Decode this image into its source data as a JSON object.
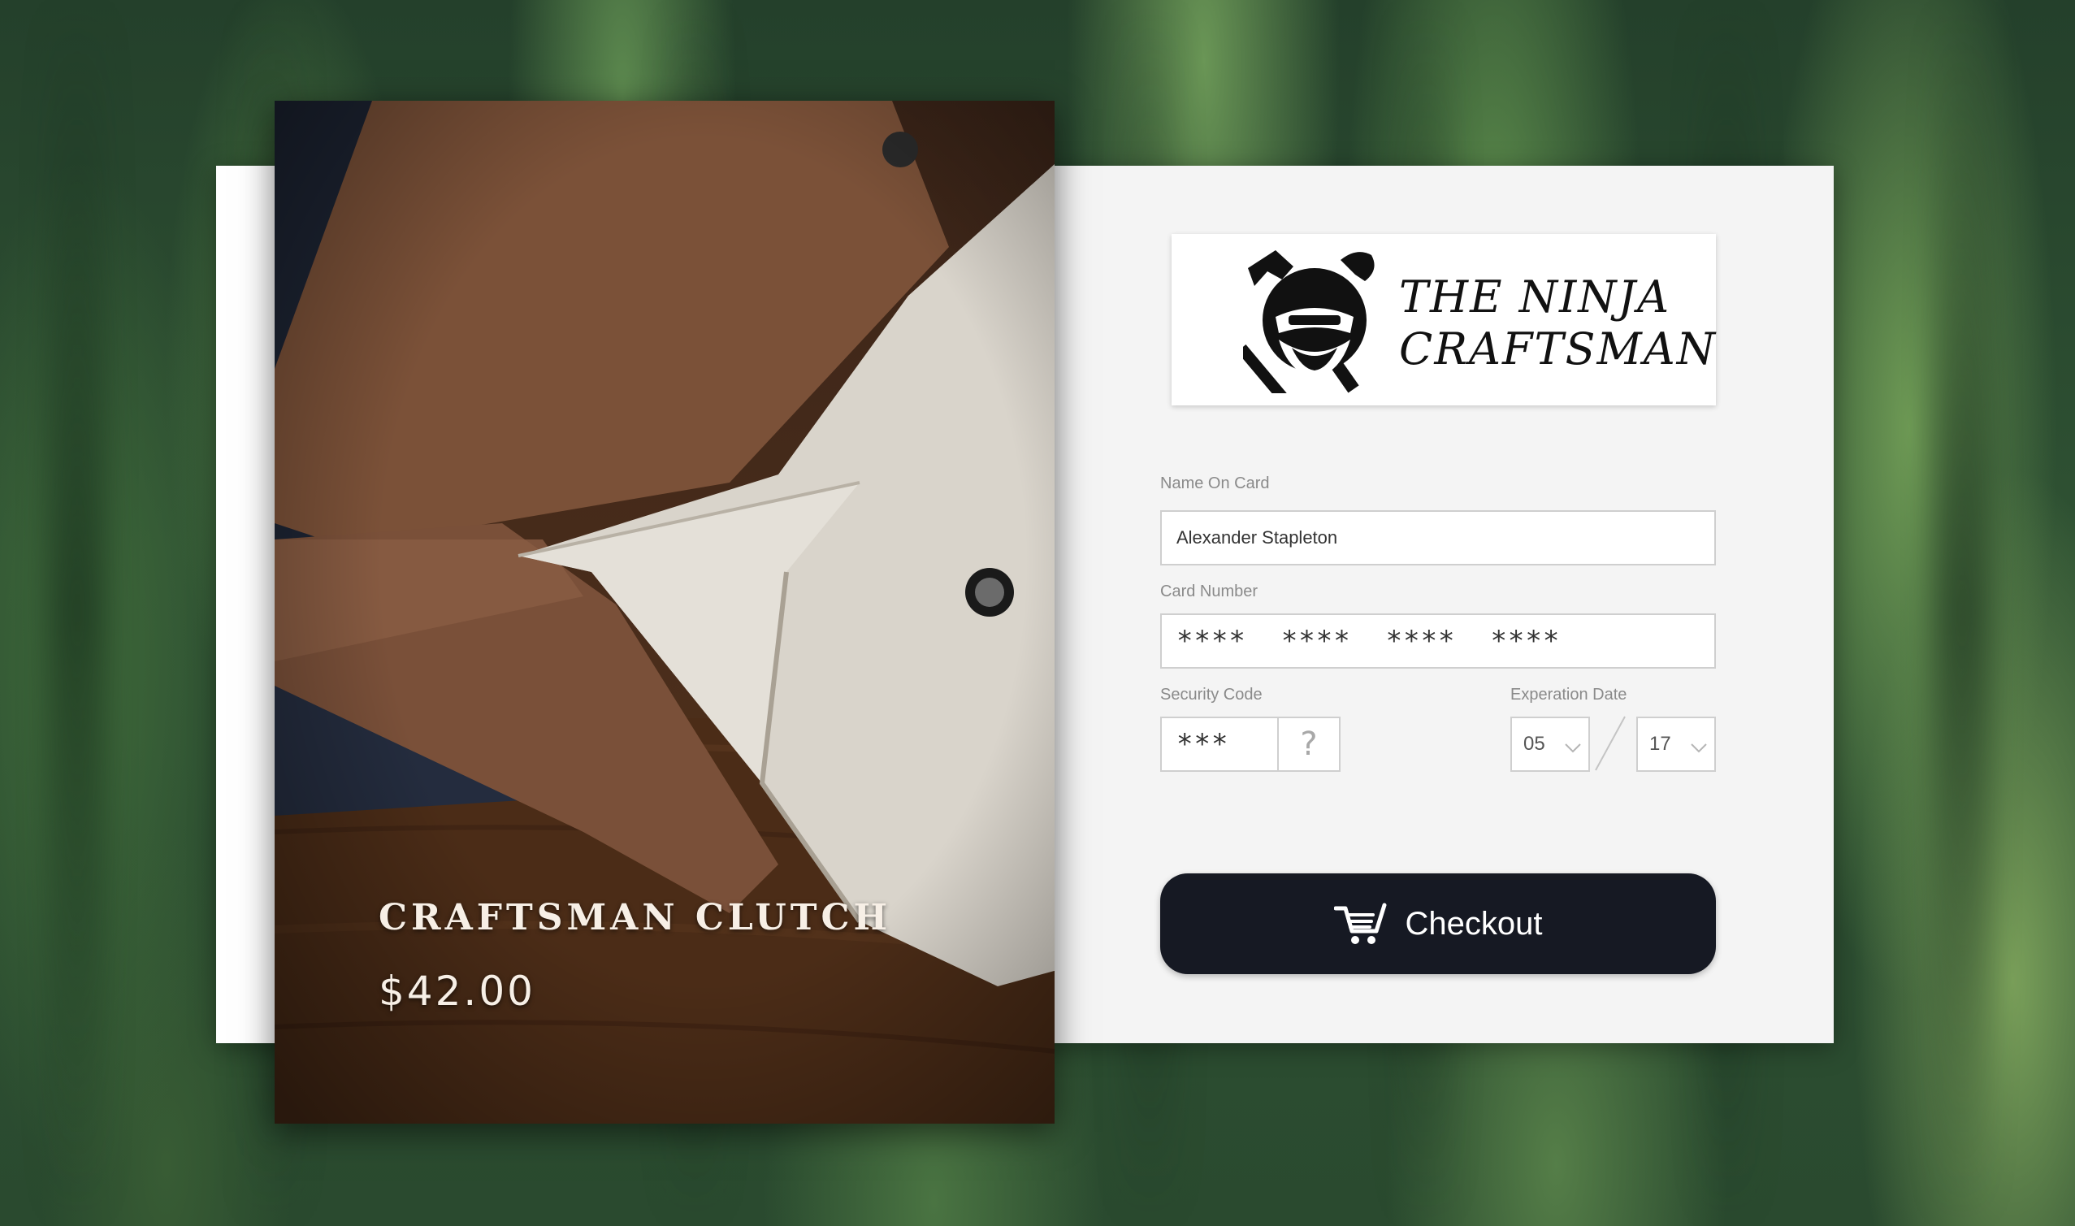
{
  "product": {
    "name": "CRAFTSMAN CLUTCH",
    "price": "$42.00"
  },
  "brand": {
    "line1": "THE NINJA",
    "line2": "CRAFTSMAN",
    "logo_icon": "ninja-hammer-logo-icon"
  },
  "form": {
    "name_label": "Name On Card",
    "name_value": "Alexander Stapleton",
    "card_label": "Card Number",
    "card_value": "****  ****  ****  ****",
    "security_label": "Security Code",
    "security_value": "***",
    "security_help": "?",
    "expiration_label": "Experation Date",
    "exp_month": "05",
    "exp_year": "17"
  },
  "checkout": {
    "label": "Checkout",
    "icon": "cart-icon"
  },
  "colors": {
    "button_bg": "#161923",
    "card_bg": "#f4f4f4",
    "label_text": "#8a8a8a"
  }
}
